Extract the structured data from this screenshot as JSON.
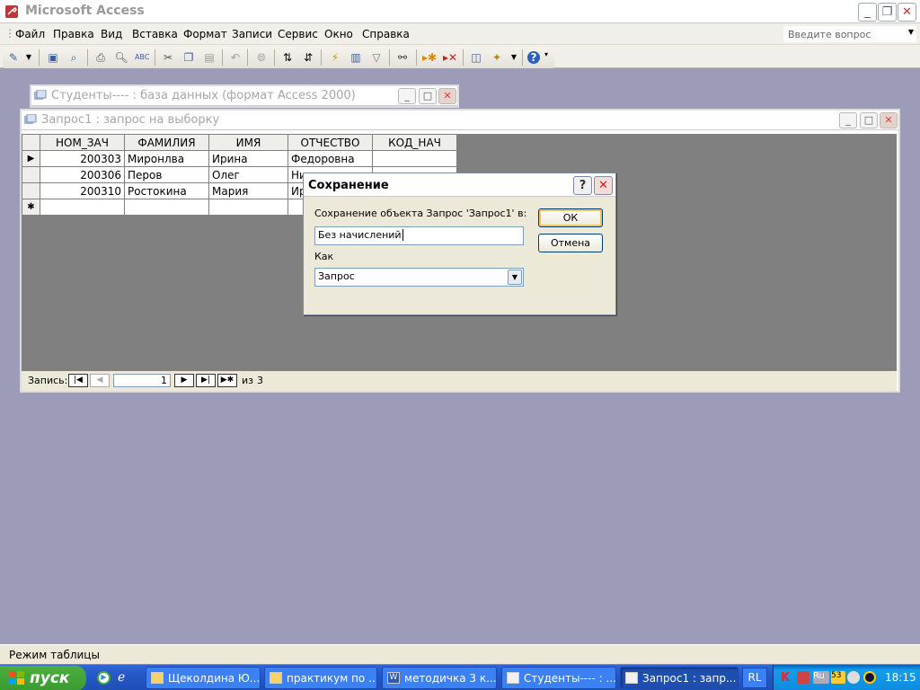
{
  "app": {
    "title": "Microsoft Access"
  },
  "menu": {
    "items": [
      "Файл",
      "Правка",
      "Вид",
      "Вставка",
      "Формат",
      "Записи",
      "Сервис",
      "Окно",
      "Справка"
    ],
    "help_placeholder": "Введите вопрос"
  },
  "toolbar": {
    "icons": [
      "view-icon",
      "save-icon",
      "search-icon",
      "print-icon",
      "preview-icon",
      "spellcheck-icon",
      "cut-icon",
      "copy-icon",
      "paste-icon",
      "undo-icon",
      "hyperlink-icon",
      "sort-asc-icon",
      "sort-desc-icon",
      "filter-selection-icon",
      "filter-form-icon",
      "apply-filter-icon",
      "find-icon",
      "new-record-icon",
      "delete-record-icon",
      "database-window-icon",
      "new-object-icon",
      "help-icon"
    ]
  },
  "db_window": {
    "title": "Студенты---- : база данных (формат Access 2000)"
  },
  "query_window": {
    "title": "Запрос1 : запрос на выборку",
    "columns": [
      "НОМ_ЗАЧ",
      "ФАМИЛИЯ",
      "ИМЯ",
      "ОТЧЕСТВО",
      "КОД_НАЧ"
    ],
    "rows": [
      [
        "200303",
        "Миронлва",
        "Ирина",
        "Федоровна",
        ""
      ],
      [
        "200306",
        "Перов",
        "Олег",
        "Ни",
        ""
      ],
      [
        "200310",
        "Ростокина",
        "Мария",
        "Ир",
        ""
      ]
    ],
    "nav": {
      "label": "Запись:",
      "current": "1",
      "of": "из",
      "total": "3"
    }
  },
  "dialog": {
    "title": "Сохранение",
    "prompt": "Сохранение объекта Запрос 'Запрос1' в:",
    "name_value": "Без начислений",
    "as_label": "Как",
    "type_value": "Запрос",
    "ok_label": "ОК",
    "cancel_label": "Отмена"
  },
  "status": {
    "text": "Режим таблицы"
  },
  "taskbar": {
    "start_label": "пуск",
    "tasks": [
      "Щеколдина Ю....",
      "практикум по ...",
      "методичка 3 к...",
      "Студенты---- : ...",
      "Запрос1 : запр..."
    ],
    "lang": "RL",
    "clock": "18:15"
  },
  "colors": {
    "desktop": "#9c9cb8",
    "grid_bg": "#808080",
    "taskbar": "#245edb",
    "start": "#3a9a30"
  }
}
